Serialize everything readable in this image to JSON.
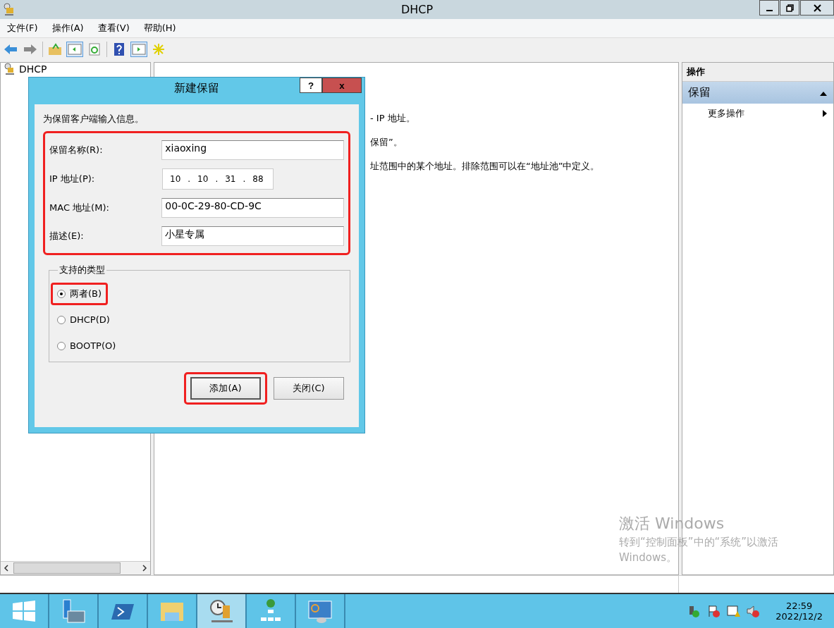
{
  "window": {
    "title": "DHCP"
  },
  "menu": [
    {
      "label": "文件(F)"
    },
    {
      "label": "操作(A)"
    },
    {
      "label": "查看(V)"
    },
    {
      "label": "帮助(H)"
    }
  ],
  "tree": {
    "root": "DHCP"
  },
  "content": {
    "lines": [
      "- IP 地址。",
      "保留”。",
      "址范围中的某个地址。排除范围可以在“地址池”中定义。"
    ]
  },
  "actions": {
    "header": "操作",
    "section": "保留",
    "expanded": true,
    "items": [
      {
        "label": "更多操作"
      }
    ]
  },
  "dialog": {
    "title": "新建保留",
    "help": "?",
    "close": "x",
    "intro": "为保留客户端输入信息。",
    "fields_highlighted": true,
    "fields": [
      {
        "kind": "text",
        "label": "保留名称(R):",
        "value": "xiaoxing"
      },
      {
        "kind": "ip",
        "label": "IP 地址(P):",
        "octets": [
          "10",
          "10",
          "31",
          "88"
        ],
        "separator": "."
      },
      {
        "kind": "text",
        "label": "MAC 地址(M):",
        "value": "00-0C-29-80-CD-9C"
      },
      {
        "kind": "text",
        "label": "描述(E):",
        "value": "小星专属"
      }
    ],
    "group": "支持的类型",
    "options": [
      {
        "label": "两者(B)",
        "selected": true,
        "highlighted": true
      },
      {
        "label": "DHCP(D)",
        "selected": false,
        "highlighted": false
      },
      {
        "label": "BOOTP(O)",
        "selected": false,
        "highlighted": false
      }
    ],
    "buttons": [
      {
        "label": "添加(A)",
        "highlighted": true
      },
      {
        "label": "关闭(C)",
        "highlighted": false
      }
    ]
  },
  "activation": {
    "title": "激活 Windows",
    "line1": "转到“控制面板”中的“系统”以激活",
    "line2": "Windows。"
  },
  "taskbar": {
    "apps": [
      {
        "selected": false
      },
      {
        "selected": false
      },
      {
        "selected": false
      },
      {
        "selected": true
      },
      {
        "selected": false
      },
      {
        "selected": false
      }
    ],
    "time": "22:59",
    "date": "2022/12/2"
  }
}
